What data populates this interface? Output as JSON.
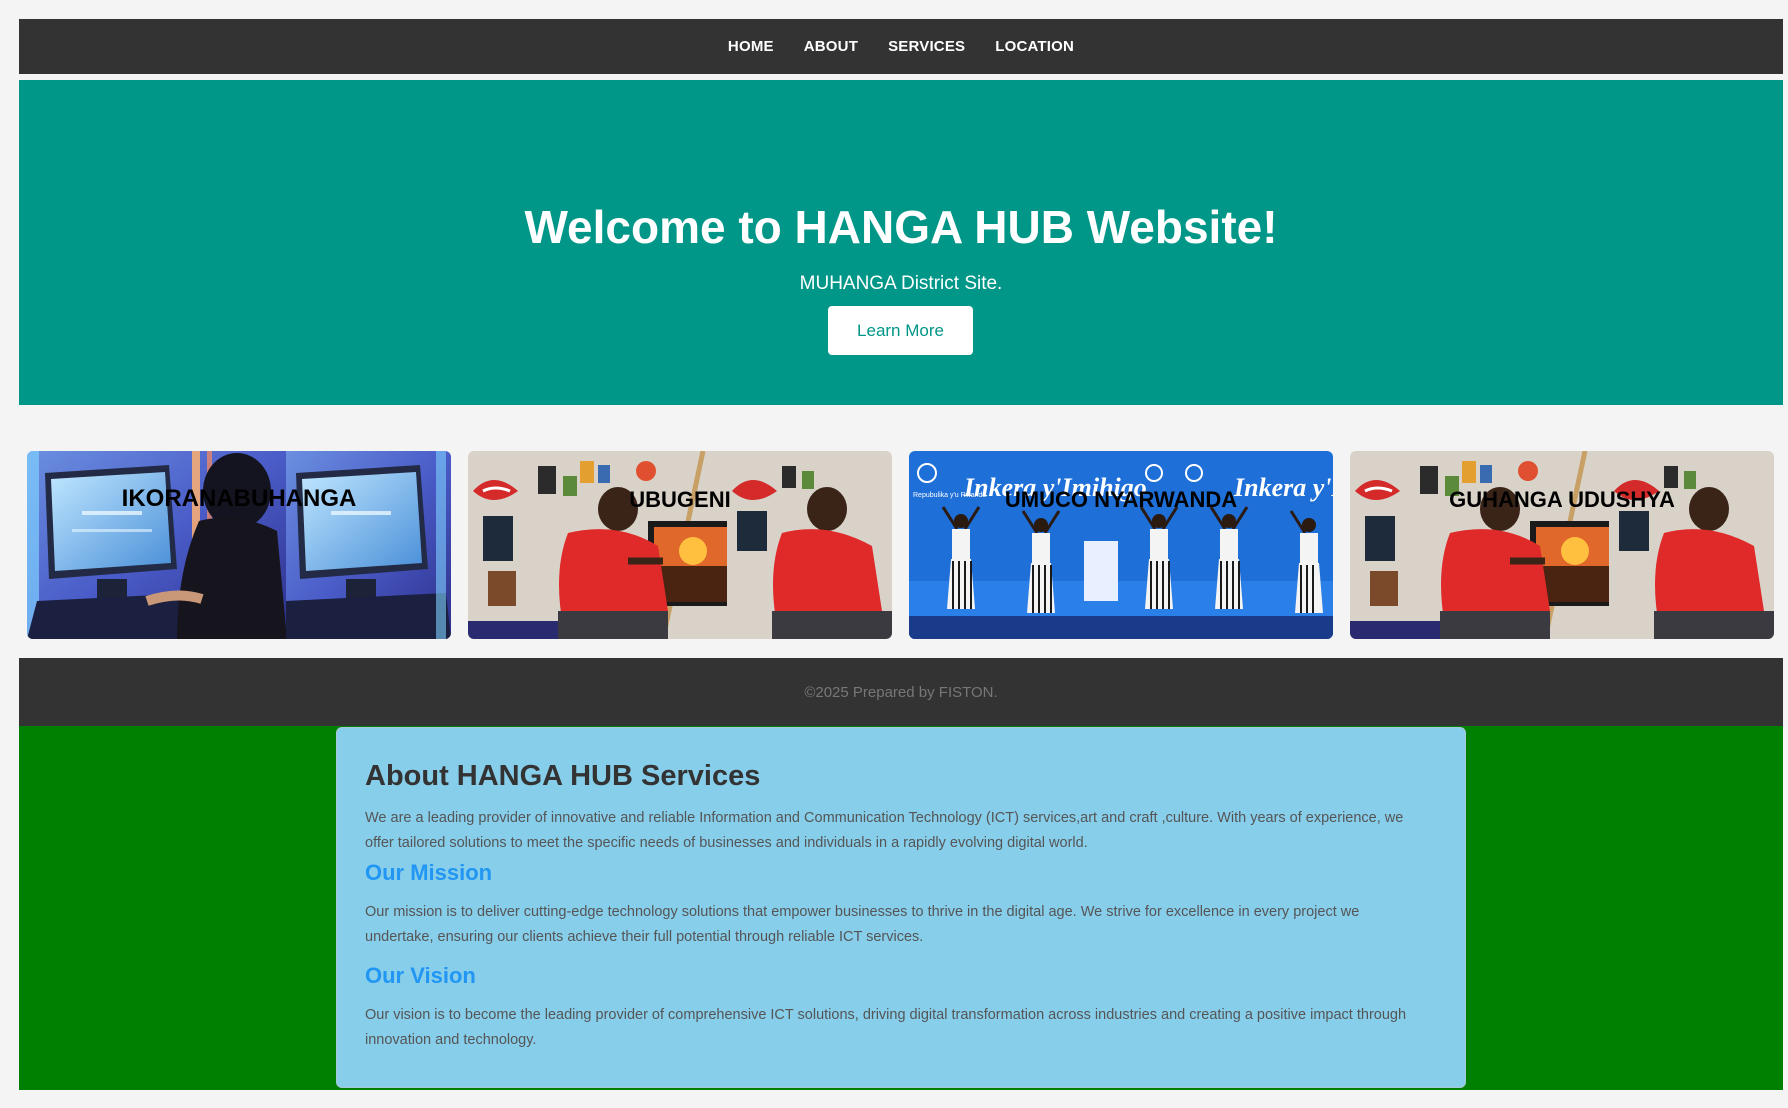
{
  "nav": {
    "items": [
      {
        "label": "HOME"
      },
      {
        "label": "ABOUT"
      },
      {
        "label": "SERVICES"
      },
      {
        "label": "LOCATION"
      }
    ]
  },
  "hero": {
    "title": "Welcome to HANGA HUB Website!",
    "subtitle": "MUHANGA District Site.",
    "button_label": "Learn More"
  },
  "cards": [
    {
      "title": "IKORANABUHANGA"
    },
    {
      "title": "UBUGENI"
    },
    {
      "title": "UMUCO NYARWANDA"
    },
    {
      "title": "GUHANGA UDUSHYA"
    }
  ],
  "card_images": {
    "banner_text": "Inkera y'Imihigo",
    "emblem_text": "Repubulika y'u Rwanda"
  },
  "footer": {
    "text": "©2025 Prepared by FISTON."
  },
  "about": {
    "heading": "About HANGA HUB Services",
    "intro": "We are a leading provider of innovative and reliable Information and Communication Technology (ICT) services,art and craft ,culture. With years of experience, we offer tailored solutions to meet the specific needs of businesses and individuals in a rapidly evolving digital world.",
    "mission_heading": "Our Mission",
    "mission_text": "Our mission is to deliver cutting-edge technology solutions that empower businesses to thrive in the digital age. We strive for excellence in every project we undertake, ensuring our clients achieve their full potential through reliable ICT services.",
    "vision_heading": "Our Vision",
    "vision_text": "Our vision is to become the leading provider of comprehensive ICT solutions, driving digital transformation across industries and creating a positive impact through innovation and technology."
  },
  "colors": {
    "nav_bg": "#333333",
    "hero_bg": "#009688",
    "about_section_bg": "#008000",
    "about_box_bg": "#87ceeb",
    "subheading": "#2196f3"
  }
}
